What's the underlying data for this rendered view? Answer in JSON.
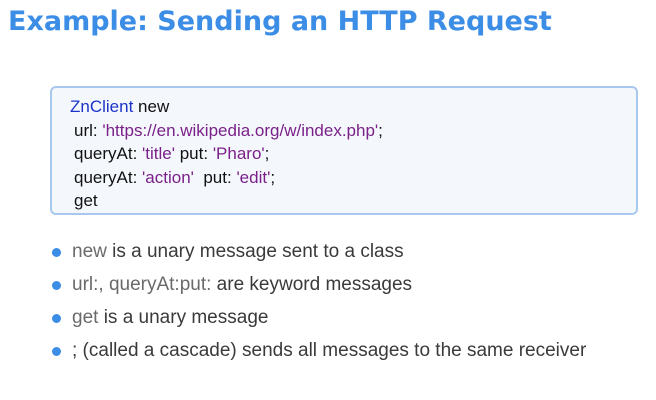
{
  "title": "Example: Sending an HTTP Request",
  "code": {
    "line1": {
      "class": "ZnClient",
      "msg": " new"
    },
    "line2": {
      "kw": "url: ",
      "str": "'https://en.wikipedia.org/w/index.php'",
      "end": ";"
    },
    "line3": {
      "kw1": "queryAt: ",
      "str1": "'title'",
      "kw2": " put: ",
      "str2": "'Pharo'",
      "end": ";"
    },
    "line4": {
      "kw1": "queryAt: ",
      "str1": "'action'",
      "kw2": "  put: ",
      "str2": "'edit'",
      "end": ";"
    },
    "line5": {
      "msg": "get"
    }
  },
  "bullets": [
    {
      "code": "new",
      "text": " is a unary message sent to a class"
    },
    {
      "code": "url:, queryAt:put:",
      "text": " are keyword messages"
    },
    {
      "code": "get",
      "text": " is a unary message"
    },
    {
      "code": "",
      "text": "; (called a cascade) sends all messages to the same receiver"
    }
  ],
  "colors": {
    "title": "#3c8de6",
    "bullet": "#3c8de6",
    "class_name": "#1b33c9",
    "string_literal": "#7a2088",
    "code_box_border": "#a8c8ec"
  }
}
